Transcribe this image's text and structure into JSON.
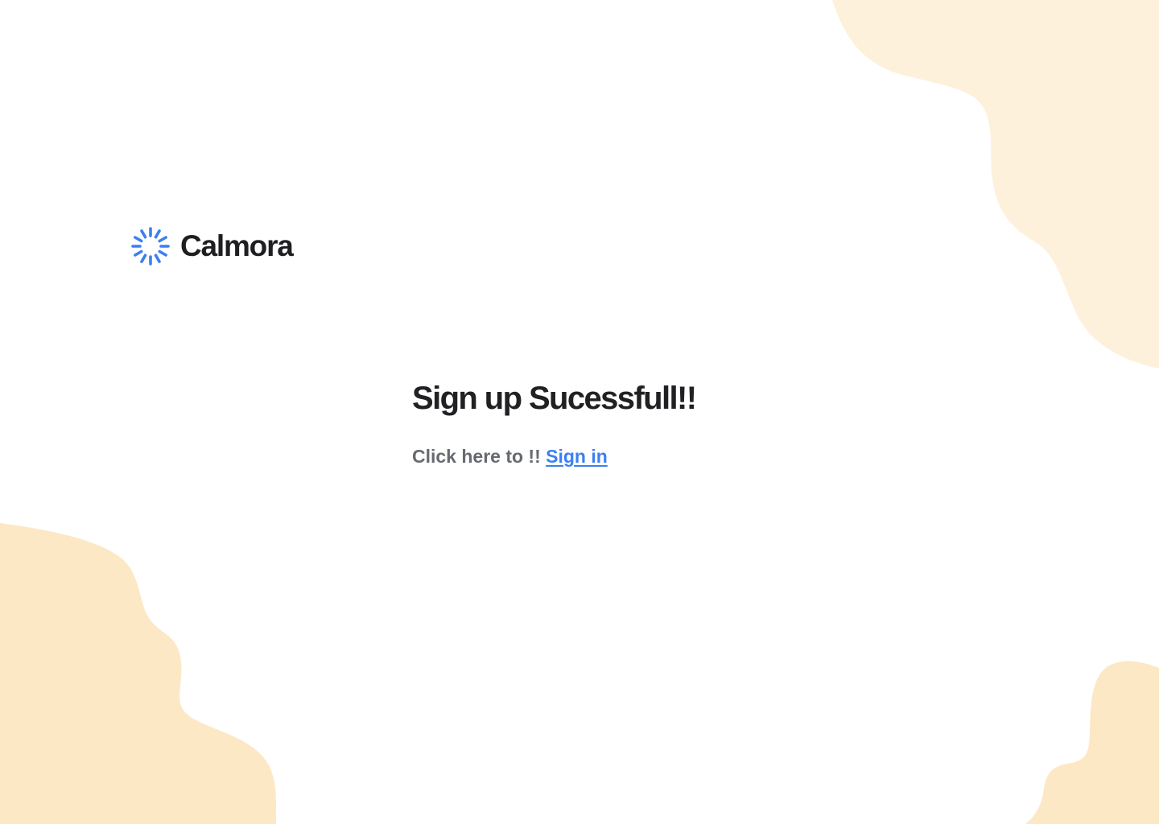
{
  "brand": {
    "name": "Calmora",
    "logo_icon": "sunburst-icon",
    "logo_color": "#3b7ff3"
  },
  "main": {
    "title": "Sign up Sucessfull!!",
    "cta_prefix": "Click here to !!",
    "cta_link": "Sign in"
  },
  "colors": {
    "background": "#ffffff",
    "accent": "#3b7ff3",
    "heading": "#212124",
    "muted_text": "#666a70",
    "blob_top": "#fef1db",
    "blob_bottom": "#fde8c6"
  }
}
